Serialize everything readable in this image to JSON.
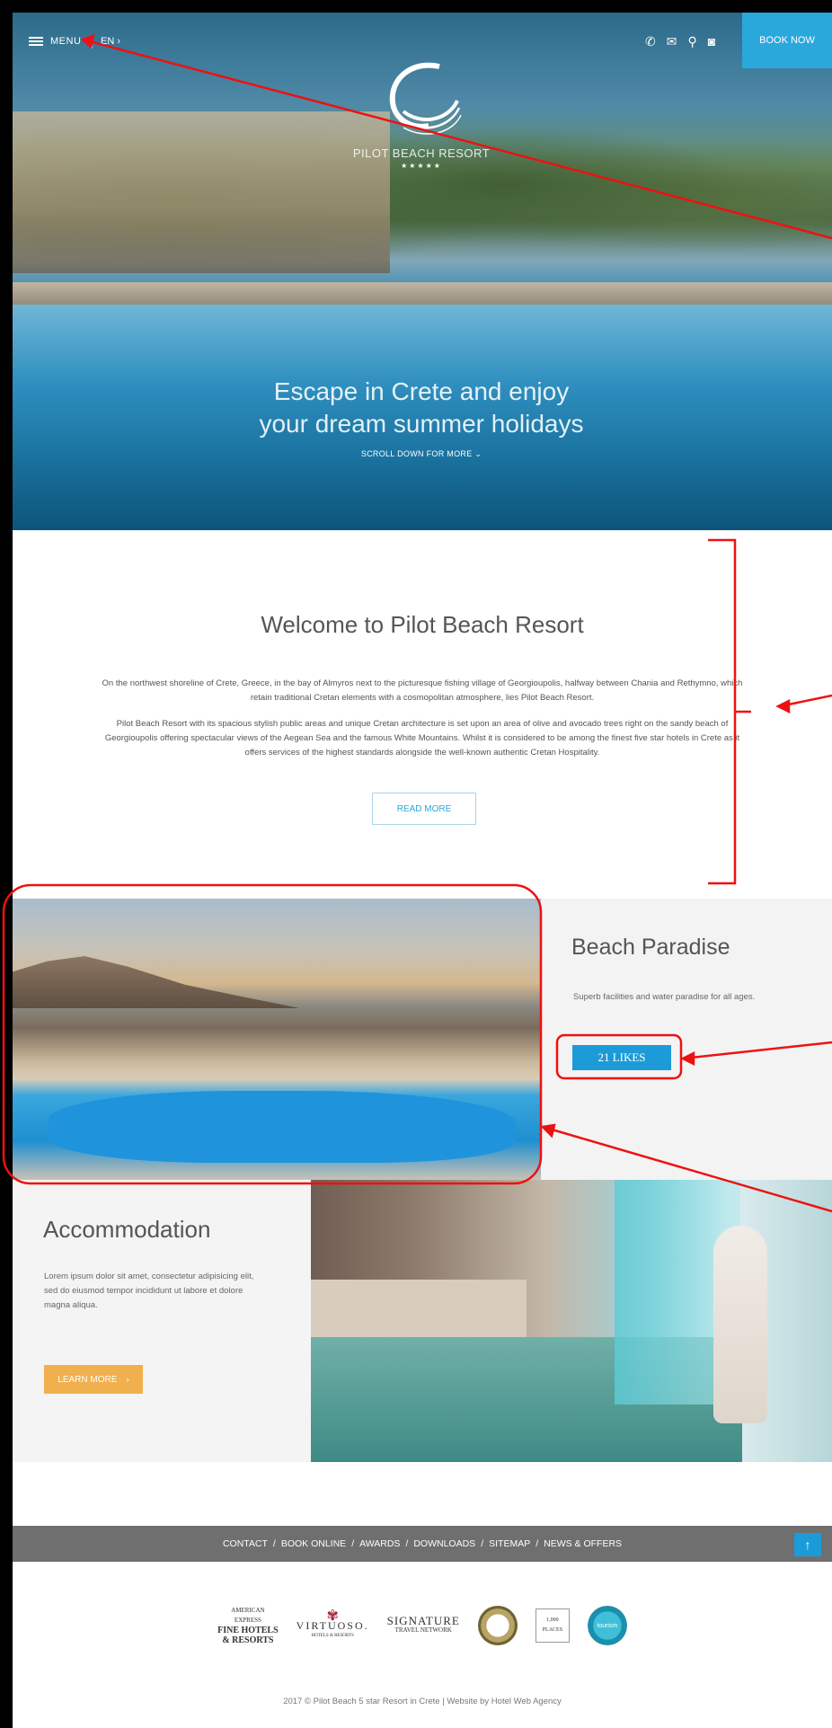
{
  "header": {
    "menu_label": "MENU",
    "language": "EN",
    "language_chevron": "›",
    "book_now": "BOOK NOW",
    "icons": [
      "phone-icon",
      "mail-icon",
      "location-icon",
      "camera-icon"
    ]
  },
  "hero": {
    "resort_name": "PILOT BEACH RESORT",
    "stars": "★★★★★",
    "title_line1": "Escape in Crete and enjoy",
    "title_line2": "your dream summer holidays",
    "scroll_label": "SCROLL DOWN FOR MORE",
    "scroll_chevron": "⌄"
  },
  "welcome": {
    "title": "Welcome to Pilot Beach Resort",
    "paragraph1": "On the northwest shoreline of Crete, Greece, in the bay of Almyros next to the picturesque fishing village of Georgioupolis, halfway between Chania and Rethymno, which retain traditional Cretan elements with a cosmopolitan atmosphere, lies Pilot Beach Resort.",
    "paragraph2": "Pilot Beach Resort with its spacious stylish public areas and unique Cretan architecture is set upon an area of olive and avocado trees right on the sandy beach of Georgioupolis offering spectacular views of the Aegean Sea and the famous White Mountains. Whilst it is considered to be among the finest five star hotels in Crete as it offers services of the highest standards alongside the well-known authentic Cretan Hospitality.",
    "read_more": "READ MORE"
  },
  "beach": {
    "title": "Beach Paradise",
    "description": "Superb facilities and water paradise for all ages.",
    "likes": "21 LIKES"
  },
  "accommodation": {
    "title": "Accommodation",
    "text": "Lorem ipsum dolor sit amet, consectetur adipisicing elit, sed do eiusmod tempor incididunt ut labore et dolore magna aliqua.",
    "learn_more": "LEARN MORE",
    "learn_chevron": "›"
  },
  "footer": {
    "links": [
      "CONTACT",
      "BOOK ONLINE",
      "AWARDS",
      "DOWNLOADS",
      "SITEMAP",
      "NEWS & OFFERS"
    ],
    "separator": "/",
    "to_top": "↑",
    "partners": {
      "amex_line1": "AMERICAN",
      "amex_line2": "EXPRESS",
      "amex_line3": "FINE HOTELS",
      "amex_line4": "& RESORTS",
      "virtuoso": "VIRTUOSO.",
      "virtuoso_sub": "HOTELS & RESORTS",
      "signature": "SIGNATURE",
      "signature_sub": "TRAVEL NETWORK",
      "thousand": "1,000 PLACES",
      "tourism": "tourism"
    },
    "copyright": "2017 © Pilot Beach 5 star Resort in Crete | Website by Hotel Web Agency"
  },
  "colors": {
    "accent_blue": "#2aa8dc",
    "accent_orange": "#f0b04d",
    "annotation_red": "#ee1111"
  }
}
